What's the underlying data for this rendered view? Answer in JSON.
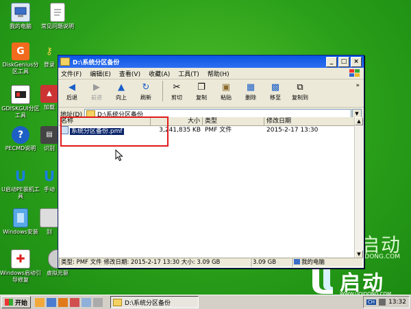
{
  "desktop": {
    "icons": [
      {
        "label": "我的电脑"
      },
      {
        "label": "常见问题说明"
      },
      {
        "label": "DiskGenius分区工具"
      },
      {
        "label": "登录"
      },
      {
        "label": "GDISKGUI分区工具"
      },
      {
        "label": "加载"
      },
      {
        "label": "PECMD说明"
      },
      {
        "label": "识别"
      },
      {
        "label": "U启动PE装机工具"
      },
      {
        "label": "手动"
      },
      {
        "label": "Windows安装"
      },
      {
        "label": "别"
      },
      {
        "label": "Windows启动引导修复"
      },
      {
        "label": "虚拟光驱"
      }
    ],
    "watermark_big": "启动",
    "watermark_small": "QIDONG.COM",
    "logo_text": "启动",
    "logo_url": "WWW.UQIDONG.COM"
  },
  "window": {
    "title": "D:\\系统分区备份",
    "menu": [
      "文件(F)",
      "编辑(E)",
      "查看(V)",
      "收藏(A)",
      "工具(T)",
      "帮助(H)"
    ],
    "toolbar": [
      {
        "label": "后退",
        "icon": "back-arrow-icon",
        "enabled": true
      },
      {
        "label": "前进",
        "icon": "forward-arrow-icon",
        "enabled": false
      },
      {
        "label": "向上",
        "icon": "up-arrow-icon",
        "enabled": true
      },
      {
        "label": "刷新",
        "icon": "refresh-icon",
        "enabled": true
      },
      {
        "label": "剪切",
        "icon": "cut-icon",
        "enabled": true
      },
      {
        "label": "复制",
        "icon": "copy-icon",
        "enabled": true
      },
      {
        "label": "粘贴",
        "icon": "paste-icon",
        "enabled": true
      },
      {
        "label": "删除",
        "icon": "delete-icon",
        "enabled": true
      },
      {
        "label": "移至",
        "icon": "move-icon",
        "enabled": true
      },
      {
        "label": "复制到",
        "icon": "copy-to-icon",
        "enabled": true
      }
    ],
    "address_label": "地址(D)",
    "address_value": "D:\\系统分区备份",
    "columns": [
      "名称",
      "大小",
      "类型",
      "修改日期"
    ],
    "files": [
      {
        "name": "系统分区备份.pmf",
        "size": "3,241,835 KB",
        "type": "PMF 文件",
        "modified": "2015-2-17 13:30"
      }
    ],
    "status": {
      "info": "类型: PMF 文件 修改日期: 2015-2-17 13:30 大小: 3.09 GB",
      "size": "3.09 GB",
      "location": "我的电脑"
    }
  },
  "taskbar": {
    "start_label": "开始",
    "task_label": "D:\\系统分区备份",
    "ime": "CH",
    "time": "13:32"
  },
  "colors": {
    "desktop": "#2fa71a",
    "titlebar": "#0a54e3",
    "selection": "#0a246a",
    "highlight_box": "#e01818"
  }
}
